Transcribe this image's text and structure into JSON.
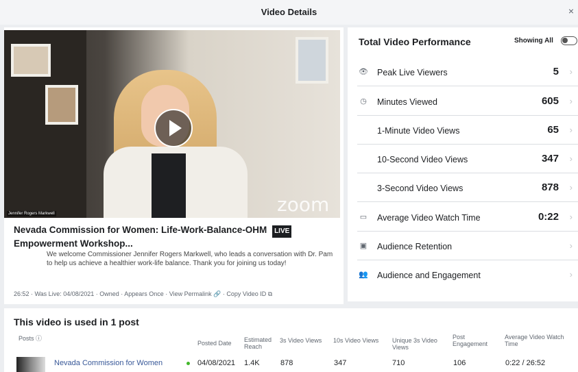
{
  "header": {
    "title": "Video Details",
    "close": "×"
  },
  "video": {
    "overlay_name": "Jennifer Rogers Markwell",
    "watermark": "zoom",
    "title": "Nevada Commission for Women: Life-Work-Balance-OHM",
    "title_line2": "Empowerment Workshop...",
    "badge": "LIVE",
    "description": "We welcome Commissioner Jennifer Rogers Markwell, who leads a conversation with Dr. Pam to help us achieve a healthier work-life balance. Thank you for joining us today!",
    "meta": "26:52 · Was Live: 04/08/2021 · Owned · Appears Once · View Permalink 🔗 · Copy Video ID ⧉"
  },
  "performance": {
    "title": "Total Video Performance",
    "showing_label": "Showing All",
    "metrics": [
      {
        "icon": "eye-icon",
        "glyph": "👁",
        "label": "Peak Live Viewers",
        "value": "5"
      },
      {
        "icon": "clock-icon",
        "glyph": "◷",
        "label": "Minutes Viewed",
        "value": "605"
      },
      {
        "icon": "none",
        "glyph": "",
        "label": "1-Minute Video Views",
        "value": "65"
      },
      {
        "icon": "none",
        "glyph": "",
        "label": "10-Second Video Views",
        "value": "347"
      },
      {
        "icon": "none",
        "glyph": "",
        "label": "3-Second Video Views",
        "value": "878"
      },
      {
        "icon": "video-icon",
        "glyph": "▭",
        "label": "Average Video Watch Time",
        "value": "0:22"
      },
      {
        "icon": "film-icon",
        "glyph": "▣",
        "label": "Audience Retention",
        "value": ""
      },
      {
        "icon": "people-icon",
        "glyph": "👥",
        "label": "Audience and Engagement",
        "value": ""
      }
    ],
    "chevron": "›"
  },
  "posts": {
    "title": "This video is used in 1 post",
    "headers": {
      "posts": "Posts",
      "info": "ⓘ",
      "posted_date": "Posted Date",
      "estimated_reach": "Estimated Reach",
      "views_3s": "3s Video Views",
      "views_10s": "10s Video Views",
      "unique_3s": "Unique 3s Video Views",
      "post_engagement": "Post Engagement",
      "avg_watch": "Average Video Watch Time"
    },
    "row": {
      "name": "Nevada Commission for Women",
      "posted_date": "04/08/2021",
      "estimated_reach": "1.4K",
      "views_3s": "878",
      "views_10s": "347",
      "unique_3s": "710",
      "post_engagement": "106",
      "avg_watch": "0:22 / 26:52"
    }
  },
  "colors": {
    "link": "#385898",
    "status_dot": "#42b72a"
  }
}
